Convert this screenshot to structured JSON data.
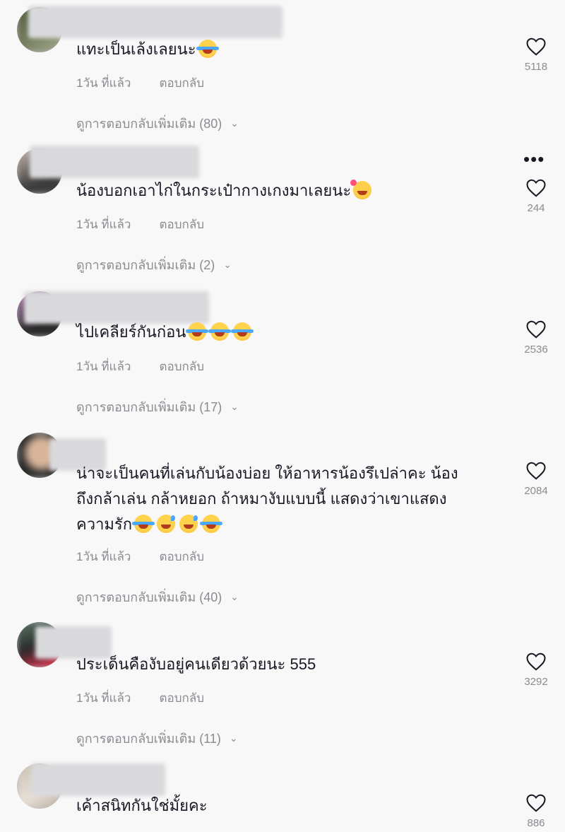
{
  "meta_labels": {
    "time": "1วัน ที่แล้ว",
    "reply": "ตอบกลับ"
  },
  "comments": [
    {
      "text": "แทะเป็นเล้งเลยนะ",
      "emojis": [
        "tear"
      ],
      "likes": "5118",
      "more_replies": "ดูการตอบกลับเพิ่มเติม (80)"
    },
    {
      "text": "น้องบอกเอาไก่ในกระเป๋ากางเกงมาเลยนะ",
      "emojis": [
        "heart"
      ],
      "likes": "244",
      "more_replies": "ดูการตอบกลับเพิ่มเติม (2)"
    },
    {
      "text": "ไปเคลียร์กันก่อน",
      "emojis": [
        "tear",
        "tear",
        "tear"
      ],
      "likes": "2536",
      "more_replies": "ดูการตอบกลับเพิ่มเติม (17)"
    },
    {
      "text_lines": [
        "น่าจะเป็นคนที่เล่นกับน้องบ่อย ให้อาหารน้องรึเปล่าคะ น้อง",
        "ถึงกล้าเล่น กล้าหยอก ถ้าหมางับแบบนี้ แสดงว่าเขาแสดง",
        "ความรัก"
      ],
      "emojis": [
        "tear",
        "sweat",
        "sweat",
        "tear"
      ],
      "likes": "2084",
      "more_replies": "ดูการตอบกลับเพิ่มเติม (40)"
    },
    {
      "text": "ประเด็นคืองับอยู่คนเดียวด้วยนะ 555",
      "emojis": [],
      "likes": "3292",
      "more_replies": "ดูการตอบกลับเพิ่มเติม (11)"
    },
    {
      "text": "เค้าสนิทกันใช่มั้ยคะ",
      "emojis": [],
      "likes": "886"
    }
  ]
}
